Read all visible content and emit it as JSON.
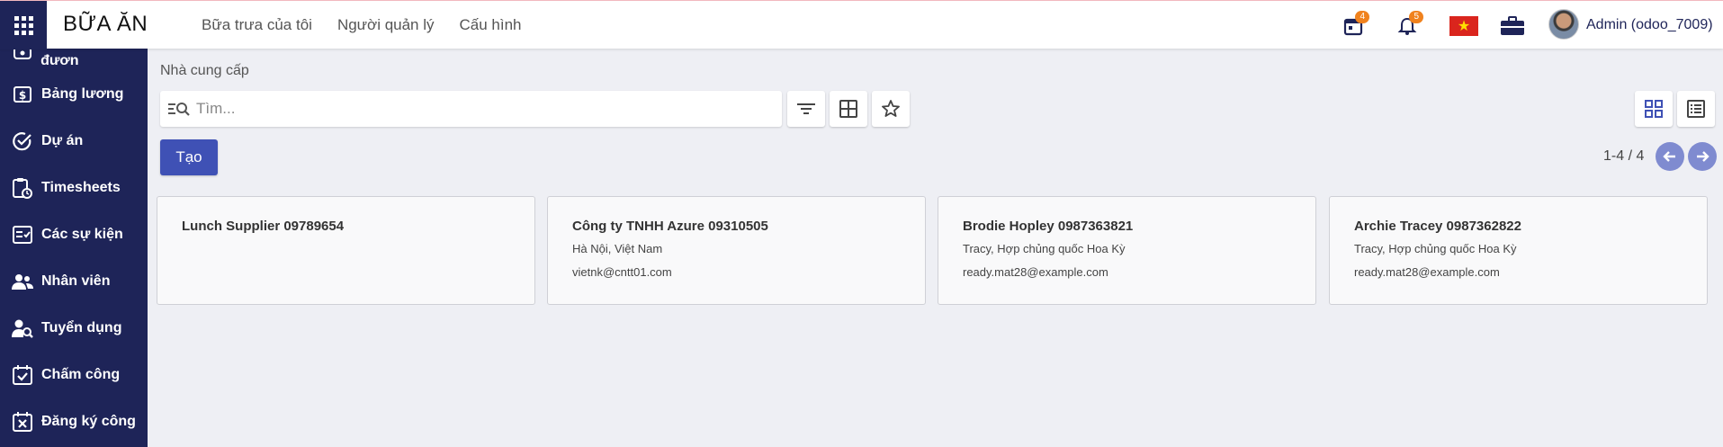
{
  "app": {
    "title": "BỮA ĂN"
  },
  "topmenu": {
    "items": [
      "Bữa trưa của tôi",
      "Người quản lý",
      "Cấu hình"
    ]
  },
  "systray": {
    "activity_count": "4",
    "notification_count": "5",
    "user": "Admin (odoo_7009)"
  },
  "sidebar": {
    "items": [
      {
        "label": "Kiểm soát đươn",
        "icon": "money-icon"
      },
      {
        "label": "Bảng lương",
        "icon": "dollar-icon"
      },
      {
        "label": "Dự án",
        "icon": "check-circle-icon"
      },
      {
        "label": "Timesheets",
        "icon": "clipboard-clock-icon"
      },
      {
        "label": "Các sự kiện",
        "icon": "event-list-icon"
      },
      {
        "label": "Nhân viên",
        "icon": "users-icon"
      },
      {
        "label": "Tuyển dụng",
        "icon": "user-search-icon"
      },
      {
        "label": "Chấm công",
        "icon": "calendar-check-icon"
      },
      {
        "label": "Đăng ký công",
        "icon": "calendar-x-icon"
      }
    ]
  },
  "page": {
    "breadcrumb": "Nhà cung cấp",
    "search_placeholder": "Tìm...",
    "create_label": "Tạo",
    "pager": "1-4 / 4"
  },
  "vendors": [
    {
      "name": "Lunch Supplier 09789654",
      "address": "",
      "email": ""
    },
    {
      "name": "Công ty TNHH Azure 09310505",
      "address": "Hà Nội, Việt Nam",
      "email": "vietnk@cntt01.com"
    },
    {
      "name": "Brodie Hopley 0987363821",
      "address": "Tracy, Hợp chủng quốc Hoa Kỳ",
      "email": "ready.mat28@example.com"
    },
    {
      "name": "Archie Tracey 0987362822",
      "address": "Tracy, Hợp chủng quốc Hoa Kỳ",
      "email": "ready.mat28@example.com"
    }
  ],
  "colors": {
    "primary": "#3f51b5",
    "sidebar": "#1e2458",
    "badge": "#f0821e",
    "background": "#eeeff4"
  }
}
